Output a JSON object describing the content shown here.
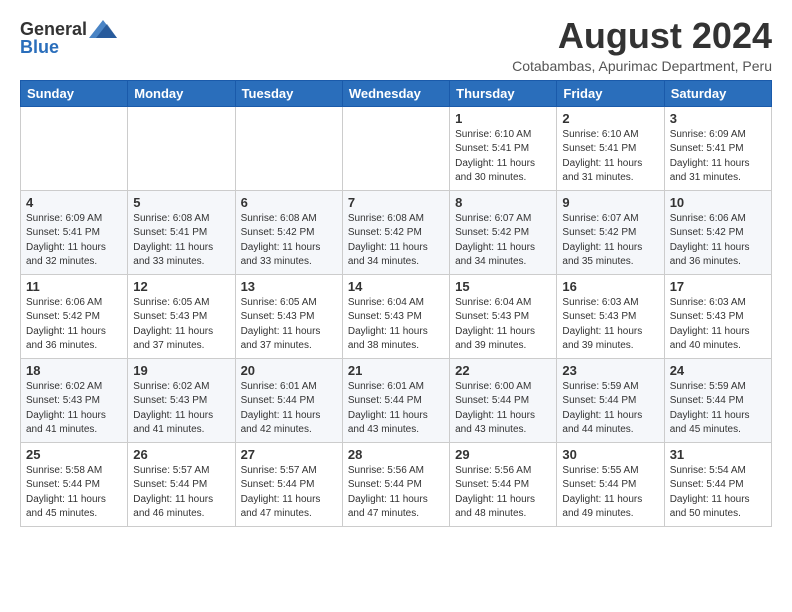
{
  "header": {
    "logo_general": "General",
    "logo_blue": "Blue",
    "month_title": "August 2024",
    "subtitle": "Cotabambas, Apurimac Department, Peru"
  },
  "days_of_week": [
    "Sunday",
    "Monday",
    "Tuesday",
    "Wednesday",
    "Thursday",
    "Friday",
    "Saturday"
  ],
  "weeks": [
    [
      {
        "day": "",
        "info": ""
      },
      {
        "day": "",
        "info": ""
      },
      {
        "day": "",
        "info": ""
      },
      {
        "day": "",
        "info": ""
      },
      {
        "day": "1",
        "info": "Sunrise: 6:10 AM\nSunset: 5:41 PM\nDaylight: 11 hours\nand 30 minutes."
      },
      {
        "day": "2",
        "info": "Sunrise: 6:10 AM\nSunset: 5:41 PM\nDaylight: 11 hours\nand 31 minutes."
      },
      {
        "day": "3",
        "info": "Sunrise: 6:09 AM\nSunset: 5:41 PM\nDaylight: 11 hours\nand 31 minutes."
      }
    ],
    [
      {
        "day": "4",
        "info": "Sunrise: 6:09 AM\nSunset: 5:41 PM\nDaylight: 11 hours\nand 32 minutes."
      },
      {
        "day": "5",
        "info": "Sunrise: 6:08 AM\nSunset: 5:41 PM\nDaylight: 11 hours\nand 33 minutes."
      },
      {
        "day": "6",
        "info": "Sunrise: 6:08 AM\nSunset: 5:42 PM\nDaylight: 11 hours\nand 33 minutes."
      },
      {
        "day": "7",
        "info": "Sunrise: 6:08 AM\nSunset: 5:42 PM\nDaylight: 11 hours\nand 34 minutes."
      },
      {
        "day": "8",
        "info": "Sunrise: 6:07 AM\nSunset: 5:42 PM\nDaylight: 11 hours\nand 34 minutes."
      },
      {
        "day": "9",
        "info": "Sunrise: 6:07 AM\nSunset: 5:42 PM\nDaylight: 11 hours\nand 35 minutes."
      },
      {
        "day": "10",
        "info": "Sunrise: 6:06 AM\nSunset: 5:42 PM\nDaylight: 11 hours\nand 36 minutes."
      }
    ],
    [
      {
        "day": "11",
        "info": "Sunrise: 6:06 AM\nSunset: 5:42 PM\nDaylight: 11 hours\nand 36 minutes."
      },
      {
        "day": "12",
        "info": "Sunrise: 6:05 AM\nSunset: 5:43 PM\nDaylight: 11 hours\nand 37 minutes."
      },
      {
        "day": "13",
        "info": "Sunrise: 6:05 AM\nSunset: 5:43 PM\nDaylight: 11 hours\nand 37 minutes."
      },
      {
        "day": "14",
        "info": "Sunrise: 6:04 AM\nSunset: 5:43 PM\nDaylight: 11 hours\nand 38 minutes."
      },
      {
        "day": "15",
        "info": "Sunrise: 6:04 AM\nSunset: 5:43 PM\nDaylight: 11 hours\nand 39 minutes."
      },
      {
        "day": "16",
        "info": "Sunrise: 6:03 AM\nSunset: 5:43 PM\nDaylight: 11 hours\nand 39 minutes."
      },
      {
        "day": "17",
        "info": "Sunrise: 6:03 AM\nSunset: 5:43 PM\nDaylight: 11 hours\nand 40 minutes."
      }
    ],
    [
      {
        "day": "18",
        "info": "Sunrise: 6:02 AM\nSunset: 5:43 PM\nDaylight: 11 hours\nand 41 minutes."
      },
      {
        "day": "19",
        "info": "Sunrise: 6:02 AM\nSunset: 5:43 PM\nDaylight: 11 hours\nand 41 minutes."
      },
      {
        "day": "20",
        "info": "Sunrise: 6:01 AM\nSunset: 5:44 PM\nDaylight: 11 hours\nand 42 minutes."
      },
      {
        "day": "21",
        "info": "Sunrise: 6:01 AM\nSunset: 5:44 PM\nDaylight: 11 hours\nand 43 minutes."
      },
      {
        "day": "22",
        "info": "Sunrise: 6:00 AM\nSunset: 5:44 PM\nDaylight: 11 hours\nand 43 minutes."
      },
      {
        "day": "23",
        "info": "Sunrise: 5:59 AM\nSunset: 5:44 PM\nDaylight: 11 hours\nand 44 minutes."
      },
      {
        "day": "24",
        "info": "Sunrise: 5:59 AM\nSunset: 5:44 PM\nDaylight: 11 hours\nand 45 minutes."
      }
    ],
    [
      {
        "day": "25",
        "info": "Sunrise: 5:58 AM\nSunset: 5:44 PM\nDaylight: 11 hours\nand 45 minutes."
      },
      {
        "day": "26",
        "info": "Sunrise: 5:57 AM\nSunset: 5:44 PM\nDaylight: 11 hours\nand 46 minutes."
      },
      {
        "day": "27",
        "info": "Sunrise: 5:57 AM\nSunset: 5:44 PM\nDaylight: 11 hours\nand 47 minutes."
      },
      {
        "day": "28",
        "info": "Sunrise: 5:56 AM\nSunset: 5:44 PM\nDaylight: 11 hours\nand 47 minutes."
      },
      {
        "day": "29",
        "info": "Sunrise: 5:56 AM\nSunset: 5:44 PM\nDaylight: 11 hours\nand 48 minutes."
      },
      {
        "day": "30",
        "info": "Sunrise: 5:55 AM\nSunset: 5:44 PM\nDaylight: 11 hours\nand 49 minutes."
      },
      {
        "day": "31",
        "info": "Sunrise: 5:54 AM\nSunset: 5:44 PM\nDaylight: 11 hours\nand 50 minutes."
      }
    ]
  ]
}
